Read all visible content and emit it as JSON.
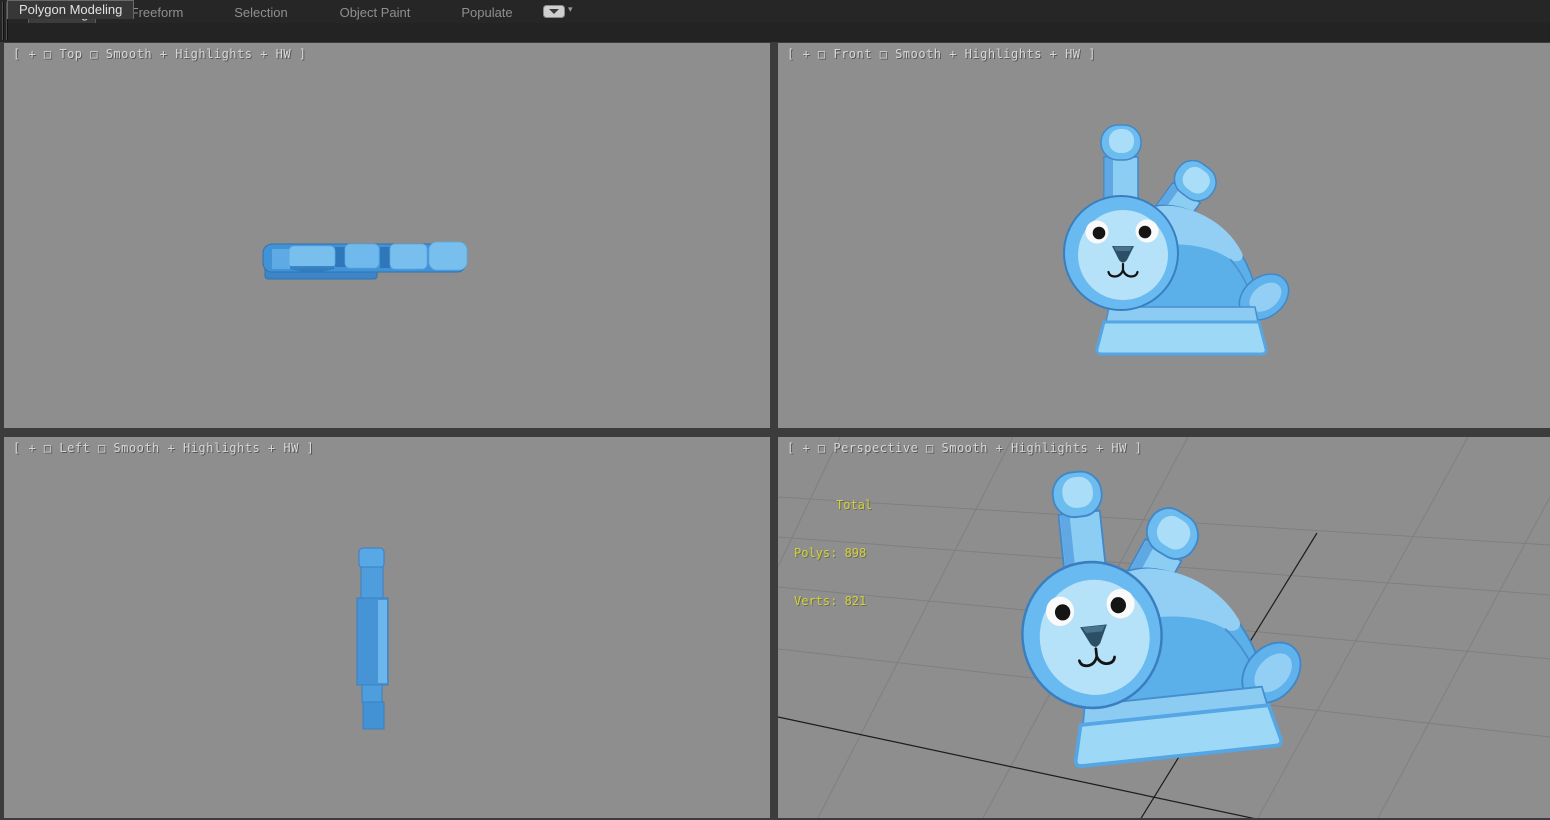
{
  "ribbon": {
    "tabs": [
      {
        "label": "Modeling",
        "active": true
      },
      {
        "label": "Freeform",
        "active": false
      },
      {
        "label": "Selection",
        "active": false
      },
      {
        "label": "Object Paint",
        "active": false
      },
      {
        "label": "Populate",
        "active": false
      }
    ],
    "minimize_caret": "▾",
    "panel_tab": "Polygon Modeling"
  },
  "viewports": {
    "top": {
      "label": "[ + □ Top □ Smooth + Highlights + HW ]"
    },
    "front": {
      "label": "[ + □ Front □ Smooth + Highlights + HW ]"
    },
    "left": {
      "label": "[ + □ Left □ Smooth + Highlights + HW ]"
    },
    "perspective": {
      "label": "[ + □ Perspective □ Smooth + Highlights + HW ]",
      "stats": {
        "title": "Total",
        "polys": "Polys: 898",
        "verts": "Verts: 821"
      }
    }
  },
  "scene": {
    "model": "blue cartoon bunny toy",
    "colors": {
      "viewport_bg": "#8e8e8e",
      "chrome_dark": "#3c3c3c",
      "ribbon_bg": "#232323",
      "stats_yellow": "#d4d23a",
      "label_gray": "#d8d8d8",
      "bunny_mid_blue": "#5fb2ec",
      "bunny_light_blue": "#b5e2f8",
      "bunny_face_blue": "#aadcf7",
      "bunny_dark_blue": "#3a7ec0",
      "grid_line": "#7d7d7d",
      "grid_axis": "#1c1c1c"
    }
  }
}
